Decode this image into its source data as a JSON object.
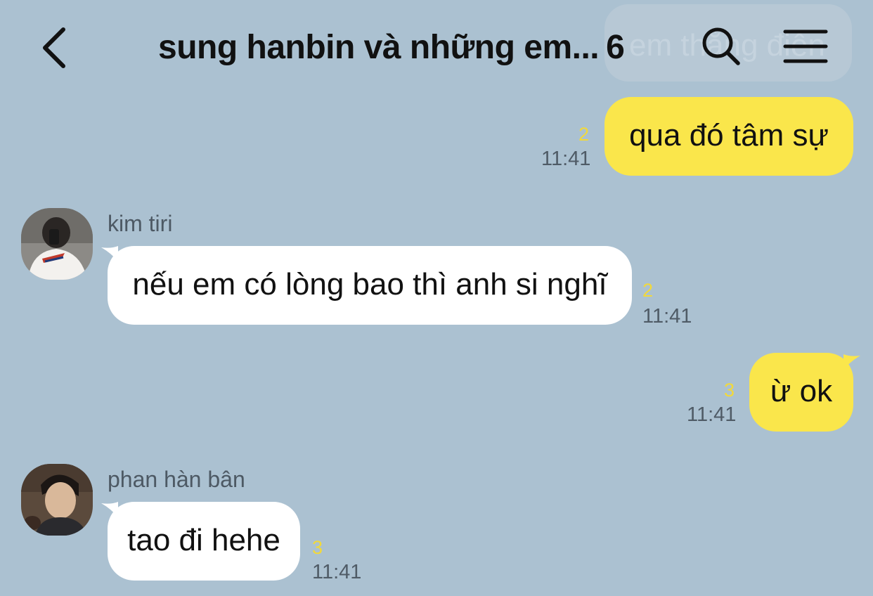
{
  "header": {
    "title": "sung hanbin và những em...",
    "member_count": "6",
    "ghost_preview": "em thằng điên",
    "icons": {
      "back": "chevron-left-icon",
      "search": "search-icon",
      "menu": "hamburger-menu-icon"
    }
  },
  "messages": [
    {
      "direction": "out",
      "text": "qua đó tâm sự",
      "unread": "2",
      "time": "11:41"
    },
    {
      "direction": "in",
      "sender": "kim tiri",
      "text": "nếu em có lòng bao thì anh si nghĩ",
      "unread": "2",
      "time": "11:41"
    },
    {
      "direction": "out",
      "text": "ừ ok",
      "unread": "3",
      "time": "11:41"
    },
    {
      "direction": "in",
      "sender": "phan hàn bân",
      "text": "tao đi hehe",
      "unread": "3",
      "time": "11:41"
    }
  ],
  "colors": {
    "background": "#abc1d1",
    "outgoing_bubble": "#fae64b",
    "incoming_bubble": "#ffffff",
    "unread_count": "#f2d93a"
  }
}
